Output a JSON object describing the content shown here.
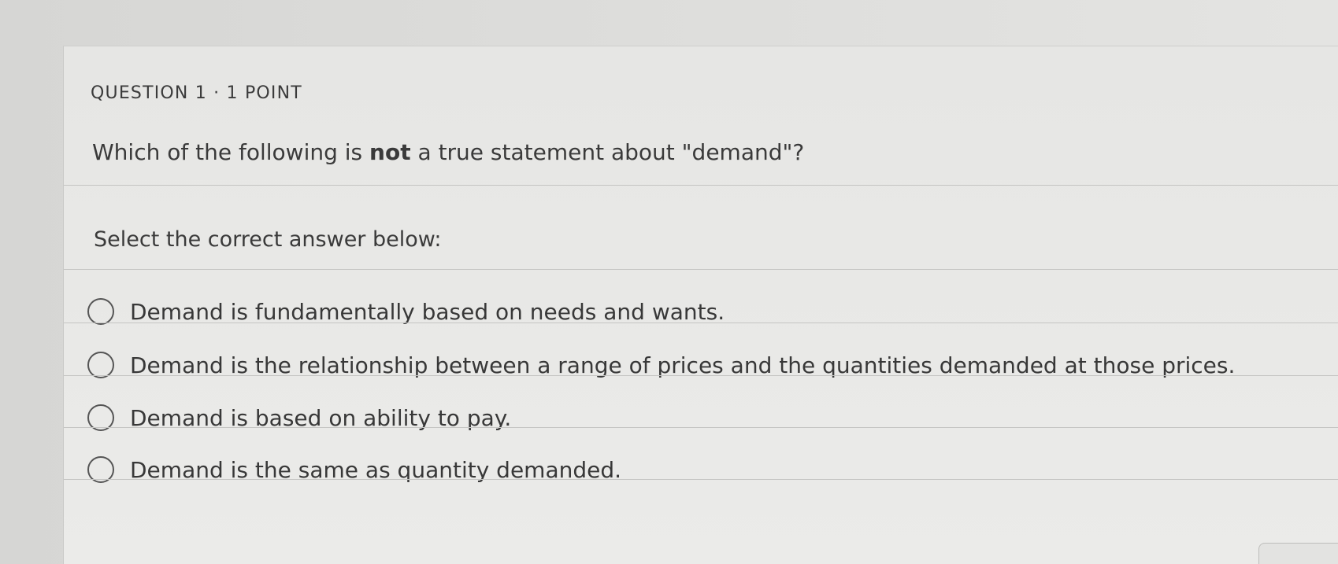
{
  "question": {
    "header": "QUESTION 1 · 1 POINT",
    "text_before": "Which of the following is ",
    "text_bold": "not",
    "text_after": " a true statement about \"demand\"?"
  },
  "instruction": "Select the correct answer below:",
  "choices": [
    {
      "label": "Demand is fundamentally based on needs and wants."
    },
    {
      "label": "Demand is the relationship between a range of prices and the quantities demanded at those prices."
    },
    {
      "label": "Demand is based on ability to pay."
    },
    {
      "label": "Demand is the same as quantity demanded."
    }
  ]
}
